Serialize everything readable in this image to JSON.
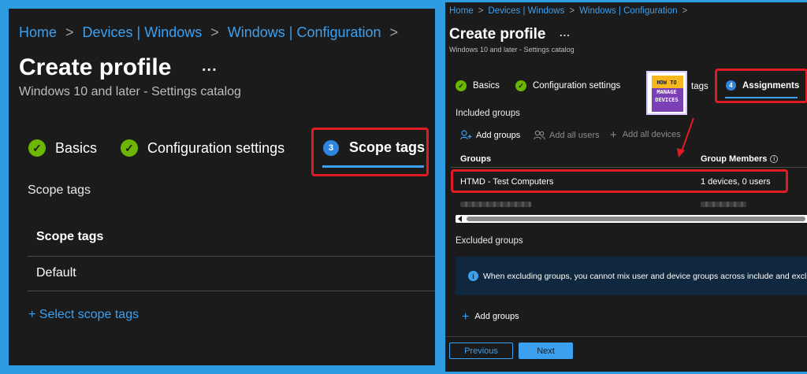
{
  "left": {
    "breadcrumb": {
      "home": "Home",
      "devices": "Devices | Windows",
      "config": "Windows | Configuration",
      "sep": ">"
    },
    "title": "Create profile",
    "more": "...",
    "subtitle": "Windows 10 and later - Settings catalog",
    "steps": {
      "basics": "Basics",
      "config": "Configuration settings",
      "scope_num": "3",
      "scope": "Scope tags"
    },
    "section_heading": "Scope tags",
    "table_header": "Scope tags",
    "table_value": "Default",
    "select_link": "+ Select scope tags"
  },
  "right": {
    "breadcrumb": {
      "home": "Home",
      "devices": "Devices | Windows",
      "config": "Windows | Configuration",
      "sep": ">"
    },
    "title": "Create profile",
    "more": "...",
    "subtitle": "Windows 10 and later - Settings catalog",
    "steps": {
      "basics": "Basics",
      "config": "Configuration settings",
      "tags": "tags",
      "assign_num": "4",
      "assign": "Assignments"
    },
    "logo": {
      "l1": "HOW TO",
      "l2": "MANAGE",
      "l3": "DEVICES"
    },
    "included_heading": "Included groups",
    "actions": {
      "add_groups": "Add groups",
      "add_all_users": "Add all users",
      "add_all_devices": "Add all devices"
    },
    "columns": {
      "groups": "Groups",
      "members": "Group Members"
    },
    "row": {
      "group": "HTMD - Test Computers",
      "members": "1 devices, 0 users"
    },
    "excluded_heading": "Excluded groups",
    "info_text": "When excluding groups, you cannot mix user and device groups across include and exclude",
    "add_groups_bottom": "Add groups",
    "buttons": {
      "previous": "Previous",
      "next": "Next"
    },
    "colors": {
      "accent": "#3ca0f0",
      "highlight": "#e01b24",
      "success": "#6bb700"
    }
  }
}
